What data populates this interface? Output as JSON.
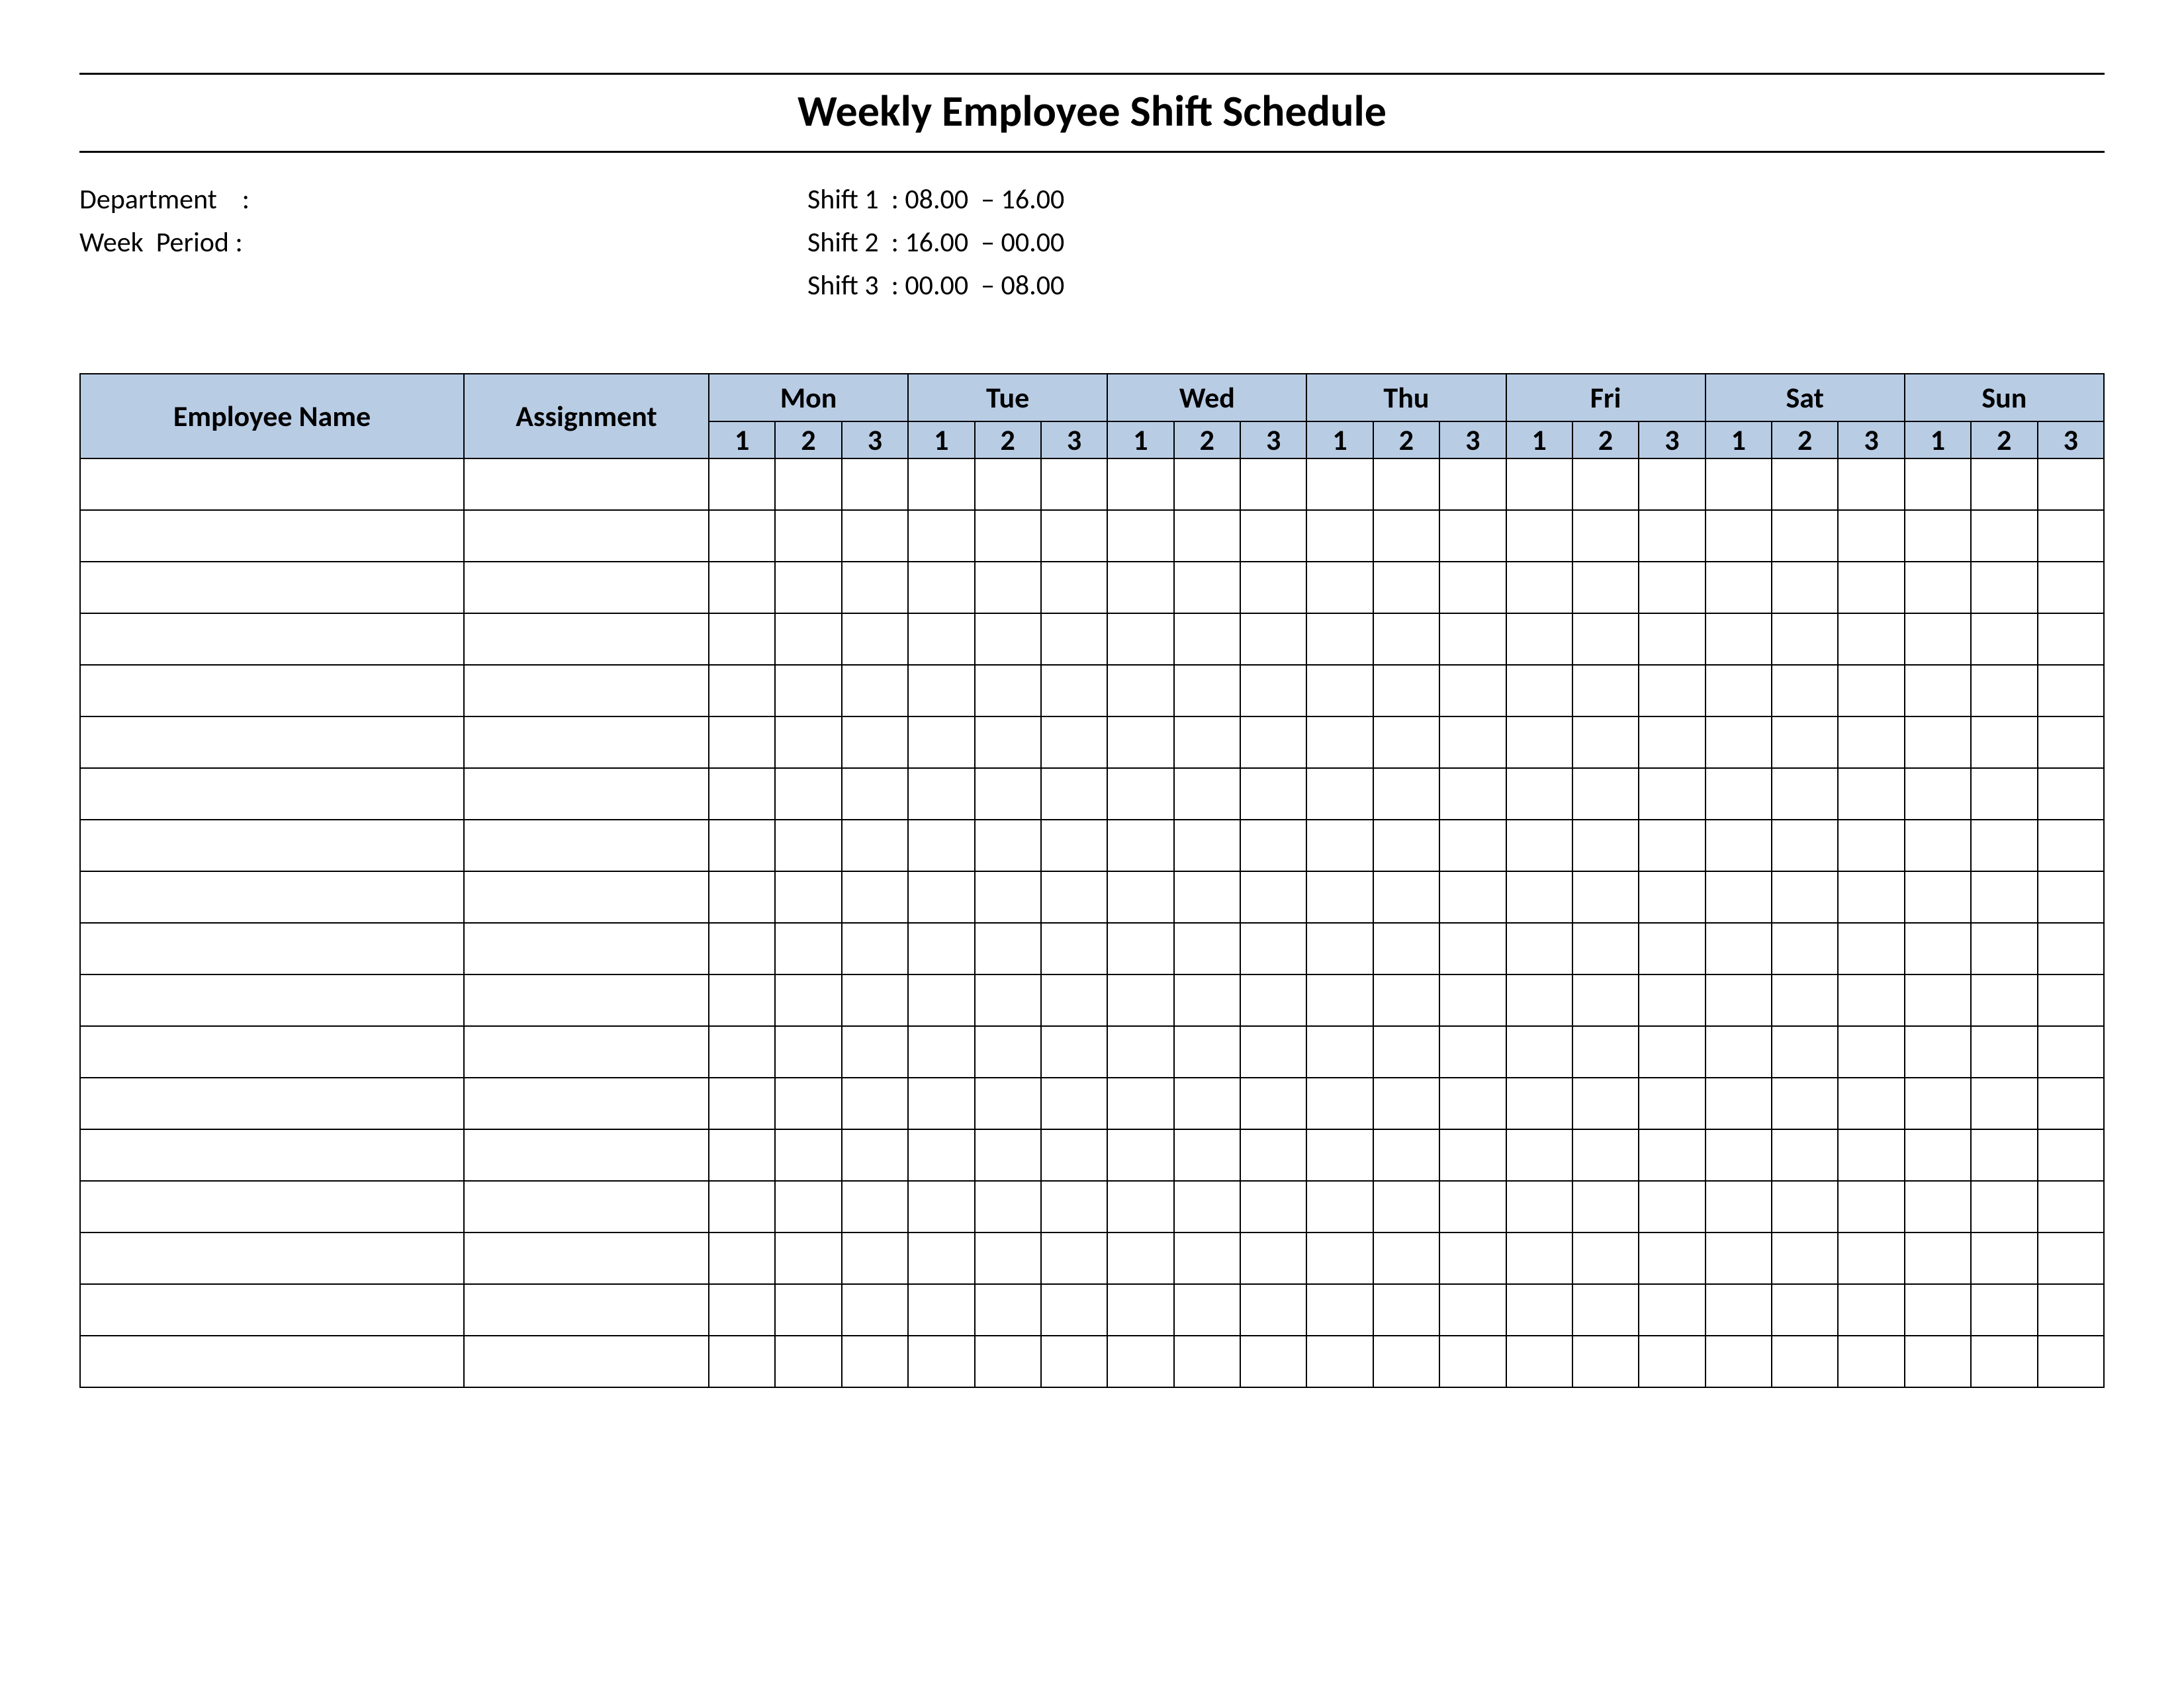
{
  "title": "Weekly Employee Shift Schedule",
  "meta": {
    "department_label": "Department    :",
    "department_value": "",
    "week_period_label": "Week  Period :",
    "week_period_value": "",
    "shift1_label": "Shift 1  :",
    "shift1_value": "08.00  – 16.00",
    "shift2_label": "Shift 2  :",
    "shift2_value": "16.00  – 00.00",
    "shift3_label": "Shift 3  :",
    "shift3_value": "00.00  – 08.00"
  },
  "headers": {
    "employee_name": "Employee Name",
    "assignment": "Assignment",
    "days": [
      "Mon",
      "Tue",
      "Wed",
      "Thu",
      "Fri",
      "Sat",
      "Sun"
    ],
    "shifts": [
      "1",
      "2",
      "3"
    ]
  },
  "rows": [
    {
      "name": "",
      "assignment": "",
      "cells": [
        "",
        "",
        "",
        "",
        "",
        "",
        "",
        "",
        "",
        "",
        "",
        "",
        "",
        "",
        "",
        "",
        "",
        "",
        "",
        "",
        ""
      ]
    },
    {
      "name": "",
      "assignment": "",
      "cells": [
        "",
        "",
        "",
        "",
        "",
        "",
        "",
        "",
        "",
        "",
        "",
        "",
        "",
        "",
        "",
        "",
        "",
        "",
        "",
        "",
        ""
      ]
    },
    {
      "name": "",
      "assignment": "",
      "cells": [
        "",
        "",
        "",
        "",
        "",
        "",
        "",
        "",
        "",
        "",
        "",
        "",
        "",
        "",
        "",
        "",
        "",
        "",
        "",
        "",
        ""
      ]
    },
    {
      "name": "",
      "assignment": "",
      "cells": [
        "",
        "",
        "",
        "",
        "",
        "",
        "",
        "",
        "",
        "",
        "",
        "",
        "",
        "",
        "",
        "",
        "",
        "",
        "",
        "",
        ""
      ]
    },
    {
      "name": "",
      "assignment": "",
      "cells": [
        "",
        "",
        "",
        "",
        "",
        "",
        "",
        "",
        "",
        "",
        "",
        "",
        "",
        "",
        "",
        "",
        "",
        "",
        "",
        "",
        ""
      ]
    },
    {
      "name": "",
      "assignment": "",
      "cells": [
        "",
        "",
        "",
        "",
        "",
        "",
        "",
        "",
        "",
        "",
        "",
        "",
        "",
        "",
        "",
        "",
        "",
        "",
        "",
        "",
        ""
      ]
    },
    {
      "name": "",
      "assignment": "",
      "cells": [
        "",
        "",
        "",
        "",
        "",
        "",
        "",
        "",
        "",
        "",
        "",
        "",
        "",
        "",
        "",
        "",
        "",
        "",
        "",
        "",
        ""
      ]
    },
    {
      "name": "",
      "assignment": "",
      "cells": [
        "",
        "",
        "",
        "",
        "",
        "",
        "",
        "",
        "",
        "",
        "",
        "",
        "",
        "",
        "",
        "",
        "",
        "",
        "",
        "",
        ""
      ]
    },
    {
      "name": "",
      "assignment": "",
      "cells": [
        "",
        "",
        "",
        "",
        "",
        "",
        "",
        "",
        "",
        "",
        "",
        "",
        "",
        "",
        "",
        "",
        "",
        "",
        "",
        "",
        ""
      ]
    },
    {
      "name": "",
      "assignment": "",
      "cells": [
        "",
        "",
        "",
        "",
        "",
        "",
        "",
        "",
        "",
        "",
        "",
        "",
        "",
        "",
        "",
        "",
        "",
        "",
        "",
        "",
        ""
      ]
    },
    {
      "name": "",
      "assignment": "",
      "cells": [
        "",
        "",
        "",
        "",
        "",
        "",
        "",
        "",
        "",
        "",
        "",
        "",
        "",
        "",
        "",
        "",
        "",
        "",
        "",
        "",
        ""
      ]
    },
    {
      "name": "",
      "assignment": "",
      "cells": [
        "",
        "",
        "",
        "",
        "",
        "",
        "",
        "",
        "",
        "",
        "",
        "",
        "",
        "",
        "",
        "",
        "",
        "",
        "",
        "",
        ""
      ]
    },
    {
      "name": "",
      "assignment": "",
      "cells": [
        "",
        "",
        "",
        "",
        "",
        "",
        "",
        "",
        "",
        "",
        "",
        "",
        "",
        "",
        "",
        "",
        "",
        "",
        "",
        "",
        ""
      ]
    },
    {
      "name": "",
      "assignment": "",
      "cells": [
        "",
        "",
        "",
        "",
        "",
        "",
        "",
        "",
        "",
        "",
        "",
        "",
        "",
        "",
        "",
        "",
        "",
        "",
        "",
        "",
        ""
      ]
    },
    {
      "name": "",
      "assignment": "",
      "cells": [
        "",
        "",
        "",
        "",
        "",
        "",
        "",
        "",
        "",
        "",
        "",
        "",
        "",
        "",
        "",
        "",
        "",
        "",
        "",
        "",
        ""
      ]
    },
    {
      "name": "",
      "assignment": "",
      "cells": [
        "",
        "",
        "",
        "",
        "",
        "",
        "",
        "",
        "",
        "",
        "",
        "",
        "",
        "",
        "",
        "",
        "",
        "",
        "",
        "",
        ""
      ]
    },
    {
      "name": "",
      "assignment": "",
      "cells": [
        "",
        "",
        "",
        "",
        "",
        "",
        "",
        "",
        "",
        "",
        "",
        "",
        "",
        "",
        "",
        "",
        "",
        "",
        "",
        "",
        ""
      ]
    },
    {
      "name": "",
      "assignment": "",
      "cells": [
        "",
        "",
        "",
        "",
        "",
        "",
        "",
        "",
        "",
        "",
        "",
        "",
        "",
        "",
        "",
        "",
        "",
        "",
        "",
        "",
        ""
      ]
    }
  ]
}
